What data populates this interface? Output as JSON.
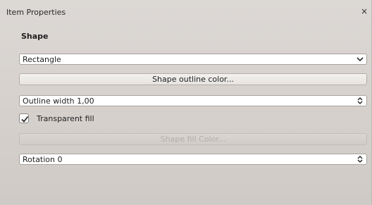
{
  "window": {
    "title": "Item Properties",
    "close_glyph": "×"
  },
  "section": {
    "title": "Shape"
  },
  "shape_type": {
    "selected": "Rectangle"
  },
  "outline_color_button": {
    "label": "Shape outline color..."
  },
  "outline_width": {
    "text": "Outline width 1,00"
  },
  "transparent_fill": {
    "label": "Transparent fill",
    "checked": true
  },
  "fill_color_button": {
    "label": "Shape fill Color...",
    "enabled": false
  },
  "rotation": {
    "text": "Rotation 0"
  },
  "icons": {
    "close": "close-icon",
    "dropdown": "chevron-down-icon",
    "spinner": "up-down-spinner-icon",
    "check": "checkmark-icon"
  }
}
